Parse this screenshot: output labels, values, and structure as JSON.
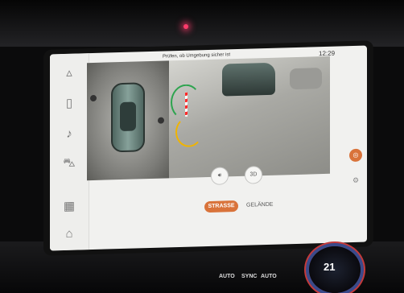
{
  "screen": {
    "hint": "Prüfen, ob Umgebung sicher ist",
    "clock": "12:29",
    "modes": {
      "active": "STRASSE",
      "other": "GELÄNDE"
    },
    "camera_buttons": {
      "left": "🔊︎",
      "three_d": "3D"
    }
  },
  "sidebar": {
    "icons": [
      "navigation-icon",
      "phone-icon",
      "music-icon",
      "car-icon",
      "apps-icon",
      "home-icon"
    ]
  },
  "console": {
    "temperature": "21",
    "labels": [
      "AUTO",
      "SYNC",
      "AUTO"
    ]
  }
}
